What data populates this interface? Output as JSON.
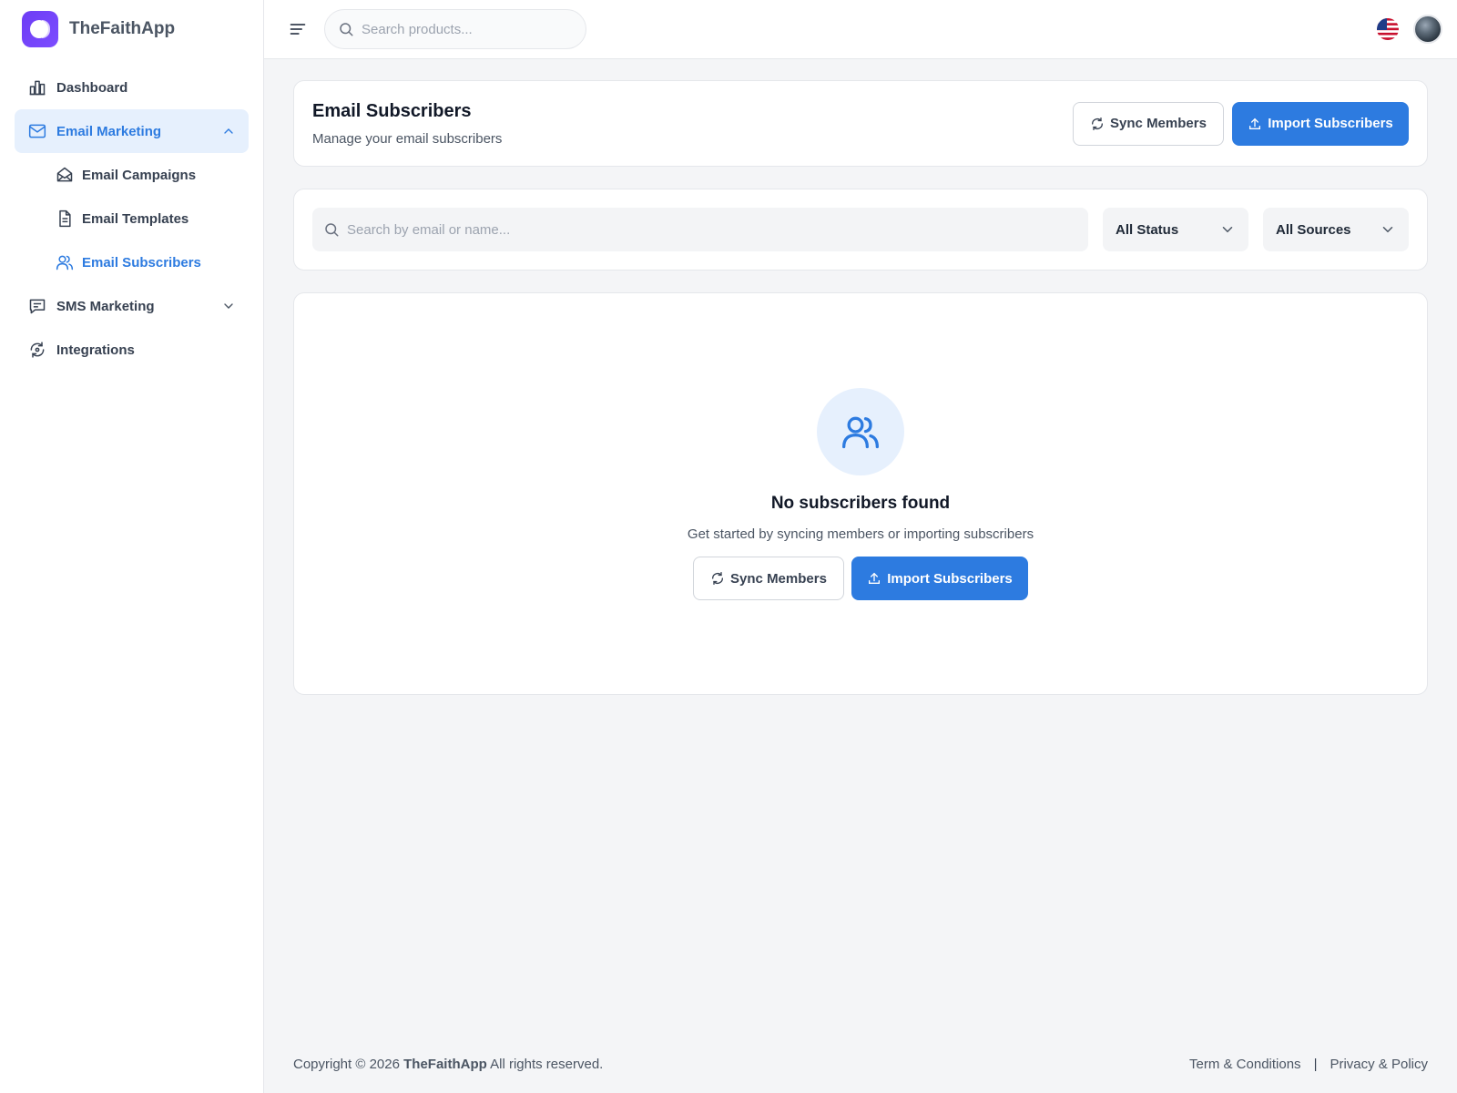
{
  "app": {
    "name": "TheFaithApp"
  },
  "header": {
    "search_placeholder": "Search products...",
    "language_icon": "us-flag-icon"
  },
  "sidebar": {
    "items": [
      {
        "label": "Dashboard",
        "icon": "bar-chart-icon"
      },
      {
        "label": "Email Marketing",
        "icon": "mail-icon",
        "expanded": true
      },
      {
        "label": "SMS Marketing",
        "icon": "message-square-icon",
        "expanded": false
      },
      {
        "label": "Integrations",
        "icon": "refresh-sync-icon"
      }
    ],
    "email_sub": [
      {
        "label": "Email Campaigns",
        "icon": "mail-open-icon"
      },
      {
        "label": "Email Templates",
        "icon": "file-text-icon"
      },
      {
        "label": "Email Subscribers",
        "icon": "users-icon",
        "active": true
      }
    ]
  },
  "page": {
    "title": "Email Subscribers",
    "subtitle": "Manage your email subscribers",
    "sync_label": "Sync Members",
    "import_label": "Import Subscribers"
  },
  "filters": {
    "search_placeholder": "Search by email or name...",
    "status_value": "All Status",
    "source_value": "All Sources"
  },
  "empty_state": {
    "title": "No subscribers found",
    "description": "Get started by syncing members or importing subscribers",
    "sync_label": "Sync Members",
    "import_label": "Import Subscribers"
  },
  "footer": {
    "copyright_prefix": "Copyright © 2026",
    "brand": "TheFaithApp",
    "copyright_suffix": "All rights reserved.",
    "terms": "Term & Conditions",
    "privacy": "Privacy & Policy"
  },
  "colors": {
    "accent": "#2d7be0",
    "accent_bg": "#e6f0fd",
    "brand": "#6d3cf5"
  }
}
